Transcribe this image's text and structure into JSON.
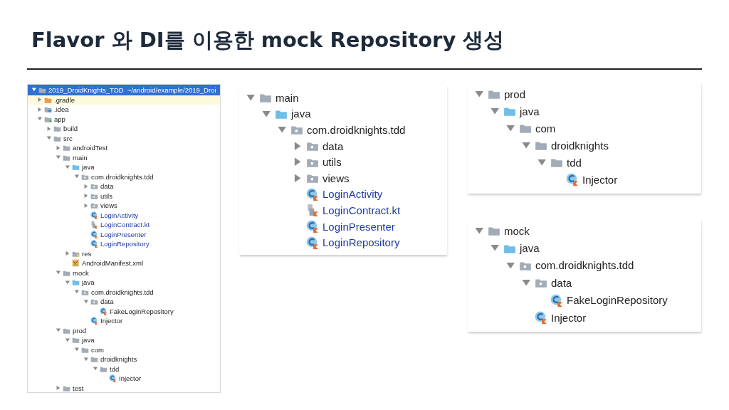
{
  "title": "Flavor 와 DI를 이용한 mock Repository 생성",
  "project_tree": {
    "root": {
      "label": "2019_DroidKnights_TDD",
      "path": "~/android/example/2019_Droi",
      "expanded": true,
      "selected": true
    },
    "children": [
      {
        "label": ".gradle",
        "kind": "gradle",
        "expanded": false,
        "highlighted": true
      },
      {
        "label": ".idea",
        "kind": "idea",
        "expanded": false
      },
      {
        "label": "app",
        "kind": "module",
        "expanded": true,
        "children": [
          {
            "label": "build",
            "kind": "folder",
            "expanded": false
          },
          {
            "label": "src",
            "kind": "folder",
            "expanded": true,
            "children": [
              {
                "label": "androidTest",
                "kind": "folder",
                "expanded": false
              },
              {
                "label": "main",
                "kind": "folder",
                "expanded": true,
                "children": [
                  {
                    "label": "java",
                    "kind": "source",
                    "expanded": true,
                    "children": [
                      {
                        "label": "com.droidknights.tdd",
                        "kind": "package",
                        "expanded": true,
                        "children": [
                          {
                            "label": "data",
                            "kind": "package",
                            "expanded": false
                          },
                          {
                            "label": "utils",
                            "kind": "package",
                            "expanded": false
                          },
                          {
                            "label": "views",
                            "kind": "package",
                            "expanded": false
                          },
                          {
                            "label": "LoginActivity",
                            "kind": "class",
                            "changed": true
                          },
                          {
                            "label": "LoginContract.kt",
                            "kind": "kotlin_file",
                            "changed": true
                          },
                          {
                            "label": "LoginPresenter",
                            "kind": "class",
                            "changed": true
                          },
                          {
                            "label": "LoginRepository",
                            "kind": "class",
                            "changed": true
                          }
                        ]
                      }
                    ]
                  },
                  {
                    "label": "res",
                    "kind": "resources",
                    "expanded": false
                  },
                  {
                    "label": "AndroidManifest.xml",
                    "kind": "manifest"
                  }
                ]
              },
              {
                "label": "mock",
                "kind": "folder",
                "expanded": true,
                "children": [
                  {
                    "label": "java",
                    "kind": "source",
                    "expanded": true,
                    "children": [
                      {
                        "label": "com.droidknights.tdd",
                        "kind": "package",
                        "expanded": true,
                        "children": [
                          {
                            "label": "data",
                            "kind": "package",
                            "expanded": true,
                            "children": [
                              {
                                "label": "FakeLoginRepository",
                                "kind": "class"
                              }
                            ]
                          },
                          {
                            "label": "Injector",
                            "kind": "class"
                          }
                        ]
                      }
                    ]
                  }
                ]
              },
              {
                "label": "prod",
                "kind": "folder",
                "expanded": true,
                "children": [
                  {
                    "label": "java",
                    "kind": "folder",
                    "expanded": true,
                    "children": [
                      {
                        "label": "com",
                        "kind": "folder",
                        "expanded": true,
                        "children": [
                          {
                            "label": "droidknights",
                            "kind": "folder",
                            "expanded": true,
                            "children": [
                              {
                                "label": "tdd",
                                "kind": "folder",
                                "expanded": true,
                                "children": [
                                  {
                                    "label": "Injector",
                                    "kind": "class"
                                  }
                                ]
                              }
                            ]
                          }
                        ]
                      }
                    ]
                  }
                ]
              },
              {
                "label": "test",
                "kind": "folder",
                "expanded": false
              }
            ]
          }
        ]
      }
    ]
  },
  "main_tree": {
    "children": [
      {
        "label": "main",
        "kind": "folder",
        "expanded": true,
        "children": [
          {
            "label": "java",
            "kind": "source",
            "expanded": true,
            "children": [
              {
                "label": "com.droidknights.tdd",
                "kind": "package",
                "expanded": true,
                "children": [
                  {
                    "label": "data",
                    "kind": "package",
                    "expanded": false
                  },
                  {
                    "label": "utils",
                    "kind": "package",
                    "expanded": false
                  },
                  {
                    "label": "views",
                    "kind": "package",
                    "expanded": false
                  },
                  {
                    "label": "LoginActivity",
                    "kind": "class",
                    "changed": true
                  },
                  {
                    "label": "LoginContract.kt",
                    "kind": "kotlin_file",
                    "changed": true
                  },
                  {
                    "label": "LoginPresenter",
                    "kind": "class",
                    "changed": true
                  },
                  {
                    "label": "LoginRepository",
                    "kind": "class",
                    "changed": true
                  }
                ]
              }
            ]
          }
        ]
      }
    ]
  },
  "prod_tree": {
    "children": [
      {
        "label": "prod",
        "kind": "folder",
        "expanded": true,
        "children": [
          {
            "label": "java",
            "kind": "source",
            "expanded": true,
            "children": [
              {
                "label": "com",
                "kind": "folder",
                "expanded": true,
                "children": [
                  {
                    "label": "droidknights",
                    "kind": "folder",
                    "expanded": true,
                    "children": [
                      {
                        "label": "tdd",
                        "kind": "folder",
                        "expanded": true,
                        "children": [
                          {
                            "label": "Injector",
                            "kind": "class"
                          }
                        ]
                      }
                    ]
                  }
                ]
              }
            ]
          }
        ]
      }
    ]
  },
  "mock_tree": {
    "children": [
      {
        "label": "mock",
        "kind": "folder",
        "expanded": true,
        "children": [
          {
            "label": "java",
            "kind": "source",
            "expanded": true,
            "children": [
              {
                "label": "com.droidknights.tdd",
                "kind": "package",
                "expanded": true,
                "children": [
                  {
                    "label": "data",
                    "kind": "package",
                    "expanded": true,
                    "children": [
                      {
                        "label": "FakeLoginRepository",
                        "kind": "class"
                      }
                    ]
                  },
                  {
                    "label": "Injector",
                    "kind": "class"
                  }
                ]
              }
            ]
          }
        ]
      }
    ]
  }
}
